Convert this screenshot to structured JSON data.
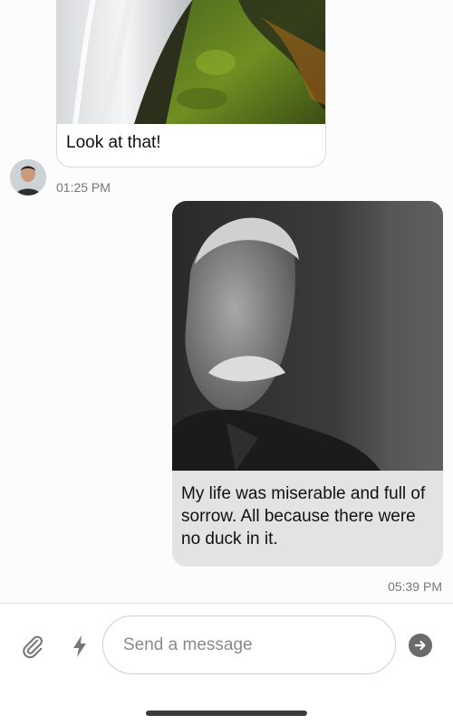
{
  "messages": {
    "incoming": {
      "text": "Look at that!",
      "time": "01:25 PM",
      "image": "waterfall-moss-photo"
    },
    "outgoing": {
      "text": "My life was miserable and full of sorrow. All because there were no duck in it.",
      "time": "05:39 PM",
      "image": "old-man-portrait-photo"
    }
  },
  "composer": {
    "placeholder": "Send a message",
    "value": "",
    "icons": [
      "paperclip-icon",
      "bolt-icon",
      "send-arrow-icon"
    ]
  },
  "colors": {
    "outgoing_bubble": "#e3e3e3",
    "send_button": "#6b6b6b",
    "timestamp": "#777777"
  }
}
